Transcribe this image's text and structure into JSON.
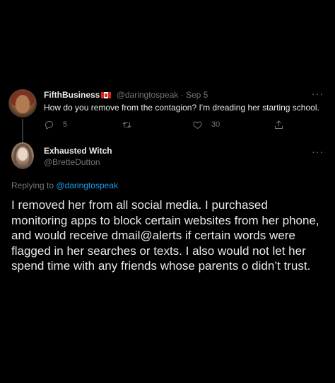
{
  "parent_tweet": {
    "display_name": "FifthBusiness",
    "flag_icon": "canada-flag-icon",
    "handle": "@daringtospeak",
    "separator": "·",
    "date": "Sep 5",
    "text": "How do you remove from the contagion? I'm dreading her starting school.",
    "reply_count": "5",
    "retweet_count": "",
    "like_count": "30",
    "more_label": "···"
  },
  "main_tweet": {
    "display_name": "Exhausted Witch",
    "handle": "@BretteDutton",
    "more_label": "···",
    "replying_prefix": "Replying to",
    "replying_to": "@daringtospeak",
    "text": "I removed her from all social media. I purchased monitoring apps to block certain websites from her phone, and would receive dmail@alerts if certain words were flagged in her searches or texts. I also would not let her spend time with any friends whose parents o didn’t trust."
  },
  "colors": {
    "background": "#000000",
    "text_primary": "#e7e9ea",
    "text_secondary": "#71767b",
    "accent": "#1d9bf0",
    "thread_line": "#333639"
  }
}
